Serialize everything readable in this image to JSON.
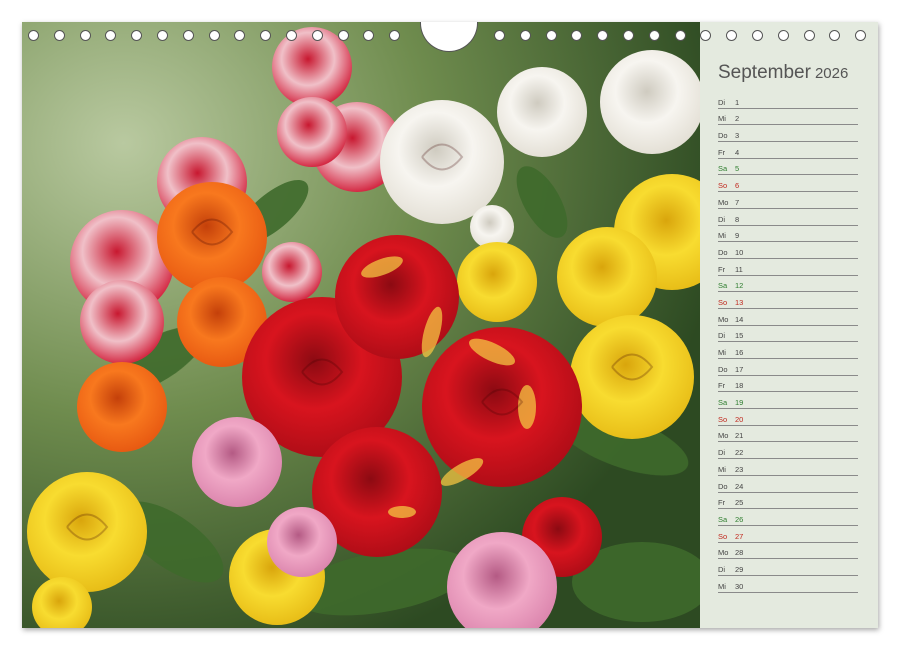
{
  "calendar": {
    "month": "September",
    "year": "2026",
    "days": [
      {
        "dw": "Di",
        "d": "1",
        "type": "weekday"
      },
      {
        "dw": "Mi",
        "d": "2",
        "type": "weekday"
      },
      {
        "dw": "Do",
        "d": "3",
        "type": "weekday"
      },
      {
        "dw": "Fr",
        "d": "4",
        "type": "weekday"
      },
      {
        "dw": "Sa",
        "d": "5",
        "type": "sat"
      },
      {
        "dw": "So",
        "d": "6",
        "type": "sun"
      },
      {
        "dw": "Mo",
        "d": "7",
        "type": "weekday"
      },
      {
        "dw": "Di",
        "d": "8",
        "type": "weekday"
      },
      {
        "dw": "Mi",
        "d": "9",
        "type": "weekday"
      },
      {
        "dw": "Do",
        "d": "10",
        "type": "weekday"
      },
      {
        "dw": "Fr",
        "d": "11",
        "type": "weekday"
      },
      {
        "dw": "Sa",
        "d": "12",
        "type": "sat"
      },
      {
        "dw": "So",
        "d": "13",
        "type": "sun"
      },
      {
        "dw": "Mo",
        "d": "14",
        "type": "weekday"
      },
      {
        "dw": "Di",
        "d": "15",
        "type": "weekday"
      },
      {
        "dw": "Mi",
        "d": "16",
        "type": "weekday"
      },
      {
        "dw": "Do",
        "d": "17",
        "type": "weekday"
      },
      {
        "dw": "Fr",
        "d": "18",
        "type": "weekday"
      },
      {
        "dw": "Sa",
        "d": "19",
        "type": "sat"
      },
      {
        "dw": "So",
        "d": "20",
        "type": "sun"
      },
      {
        "dw": "Mo",
        "d": "21",
        "type": "weekday"
      },
      {
        "dw": "Di",
        "d": "22",
        "type": "weekday"
      },
      {
        "dw": "Mi",
        "d": "23",
        "type": "weekday"
      },
      {
        "dw": "Do",
        "d": "24",
        "type": "weekday"
      },
      {
        "dw": "Fr",
        "d": "25",
        "type": "weekday"
      },
      {
        "dw": "Sa",
        "d": "26",
        "type": "sat"
      },
      {
        "dw": "So",
        "d": "27",
        "type": "sun"
      },
      {
        "dw": "Mo",
        "d": "28",
        "type": "weekday"
      },
      {
        "dw": "Di",
        "d": "29",
        "type": "weekday"
      },
      {
        "dw": "Mi",
        "d": "30",
        "type": "weekday"
      }
    ]
  },
  "photo": {
    "subject": "rose-bouquet",
    "colors": {
      "red": "#d8141e",
      "yellow": "#f5d020",
      "white": "#f4f2ee",
      "orange": "#f06a1a",
      "pink": "#e690b4",
      "leaf": "#3f6a2c"
    }
  },
  "colors": {
    "saturday": "#2e7d2e",
    "sunday": "#c0281e",
    "sidebar_bg": "#e4eadf"
  }
}
